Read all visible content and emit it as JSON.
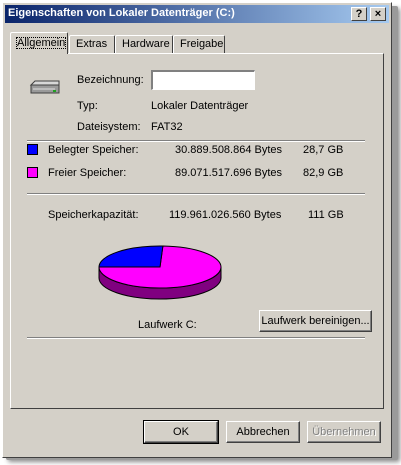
{
  "window": {
    "title": "Eigenschaften von Lokaler Datenträger (C:)",
    "help_button": "?",
    "close_button": "×"
  },
  "tabs": [
    {
      "label": "Allgemein",
      "active": true
    },
    {
      "label": "Extras",
      "active": false
    },
    {
      "label": "Hardware",
      "active": false
    },
    {
      "label": "Freigabe",
      "active": false
    }
  ],
  "general": {
    "name_label": "Bezeichnung:",
    "name_value": "",
    "type_label": "Typ:",
    "type_value": "Lokaler Datenträger",
    "filesystem_label": "Dateisystem:",
    "filesystem_value": "FAT32",
    "used_label": "Belegter Speicher:",
    "used_bytes": "30.889.508.864 Bytes",
    "used_gb": "28,7 GB",
    "free_label": "Freier Speicher:",
    "free_bytes": "89.071.517.696 Bytes",
    "free_gb": "82,9 GB",
    "capacity_label": "Speicherkapazität:",
    "capacity_bytes": "119.961.026.560 Bytes",
    "capacity_gb": "111 GB",
    "drive_label": "Laufwerk C:",
    "cleanup_button": "Laufwerk bereinigen..."
  },
  "pie": {
    "used_fraction": 0.2575,
    "used_color": "#0000ff",
    "free_color": "#ff00ff",
    "used_side_color": "#000080",
    "free_side_color": "#800080"
  },
  "buttons": {
    "ok": "OK",
    "cancel": "Abbrechen",
    "apply": "Übernehmen"
  }
}
